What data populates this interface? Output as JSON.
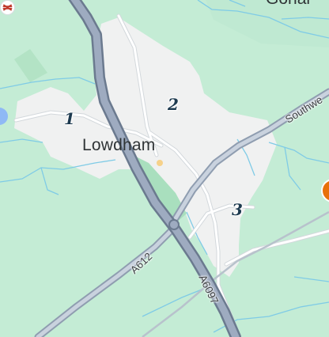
{
  "map": {
    "town_label": "Lowdham",
    "markers": [
      "1",
      "2",
      "3"
    ],
    "roads": {
      "a612": "A612",
      "a6097": "A6097",
      "southwell": "Southwe"
    },
    "partial_place_label": "Gonal"
  },
  "colors": {
    "land": "#c4ecd5",
    "built_up": "#f0f1f1",
    "trunk_road": "#7f8fa6",
    "minor_road": "#ffffff",
    "water": "#7fcbe6",
    "marker_text": "#1d3a4f",
    "station": "#c0392b"
  },
  "icons": {
    "station": "railway-station-icon",
    "poi": "orange-poi-icon",
    "location": "location-dot-icon"
  }
}
